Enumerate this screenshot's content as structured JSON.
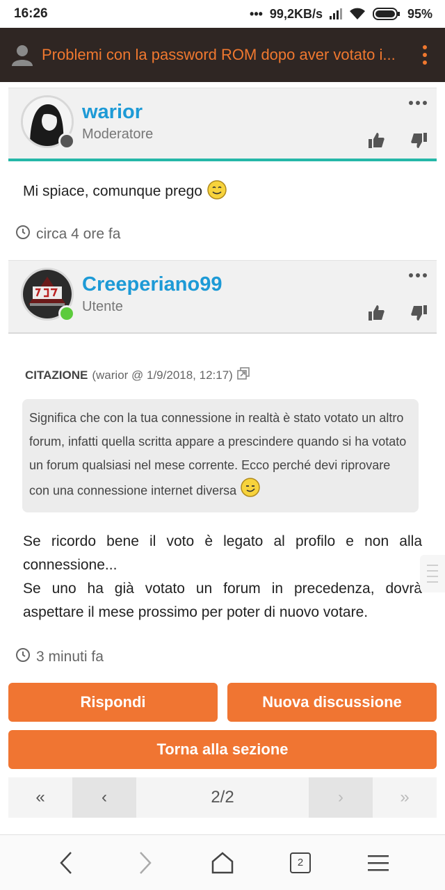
{
  "status_bar": {
    "time": "16:26",
    "speed": "99,2KB/s",
    "battery": "95%"
  },
  "app_bar": {
    "title": "Problemi con la password ROM dopo aver votato i..."
  },
  "posts": [
    {
      "username": "warior",
      "role": "Moderatore",
      "status": "offline",
      "body": "Mi spiace, comunque prego",
      "timestamp": "circa 4 ore fa"
    },
    {
      "username": "Creeperiano99",
      "role": "Utente",
      "status": "online",
      "quote_label": "CITAZIONE",
      "quote_meta": "(warior @ 1/9/2018, 12:17)",
      "quote_text": "Significa che con la tua connessione in realtà è stato votato un altro forum, infatti quella scritta appare a prescindere quando si ha votato un forum qualsiasi nel mese corrente. Ecco perché devi riprovare con una connessione internet diversa",
      "body_line1": "Se ricordo bene il voto è legato al profilo e non alla connessione...",
      "body_line2": "Se uno ha già votato un forum in precedenza, dovrà aspettare il mese prossimo per poter di nuovo votare.",
      "timestamp": "3 minuti fa"
    }
  ],
  "buttons": {
    "reply": "Rispondi",
    "new_topic": "Nuova discussione",
    "back_to_section": "Torna alla sezione"
  },
  "pager": {
    "first": "«",
    "prev": "‹",
    "current": "2/2",
    "next": "›",
    "last": "»"
  },
  "browser_nav": {
    "tab_count": "2"
  },
  "colors": {
    "accent": "#f07532",
    "link": "#1d9ad6",
    "appbar_bg": "#2f2623",
    "teal": "#25b7a8",
    "online": "#5ccb3c",
    "offline": "#555555"
  }
}
